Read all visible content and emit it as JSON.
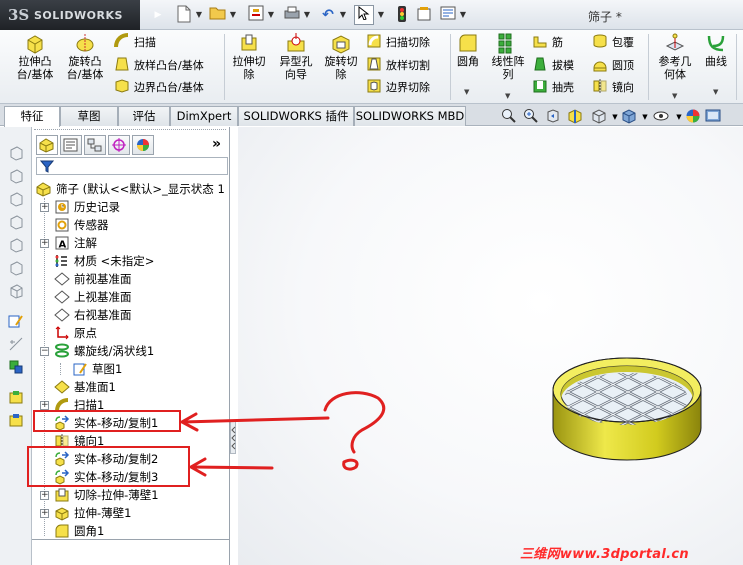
{
  "app": {
    "logo_prefix": "3S",
    "logo_name": "SOLIDWORKS",
    "document_title": "筛子 *"
  },
  "quick_toolbar": {
    "icons": [
      "new-document-icon",
      "open-icon",
      "file-properties-icon",
      "print-icon",
      "undo-icon",
      "select-icon",
      "rebuild-icon",
      "options-icon",
      "customize-icon"
    ]
  },
  "ribbon": {
    "extrude_boss": "拉伸凸台/基体",
    "extrude_boss_l1": "拉伸凸",
    "extrude_boss_l2": "台/基体",
    "revolve_boss_l1": "旋转凸",
    "revolve_boss_l2": "台/基体",
    "sweep": "扫描",
    "loft_boss": "放样凸台/基体",
    "boundary_boss": "边界凸台/基体",
    "extrude_cut_l1": "拉伸切",
    "extrude_cut_l2": "除",
    "hole_wizard_l1": "异型孔",
    "hole_wizard_l2": "向导",
    "revolve_cut_l1": "旋转切",
    "revolve_cut_l2": "除",
    "swept_cut": "扫描切除",
    "lofted_cut": "放样切割",
    "boundary_cut": "边界切除",
    "fillet": "圆角",
    "linear_pattern_l1": "线性阵",
    "linear_pattern_l2": "列",
    "rib": "筋",
    "draft": "拔模",
    "shell": "抽壳",
    "wrap": "包覆",
    "dome": "圆顶",
    "mirror": "镜向",
    "ref_geometry_l1": "参考几",
    "ref_geometry_l2": "何体",
    "curves": "曲线"
  },
  "tabs": [
    {
      "label": "特征",
      "active": true
    },
    {
      "label": "草图",
      "active": false
    },
    {
      "label": "评估",
      "active": false
    },
    {
      "label": "DimXpert",
      "active": false
    },
    {
      "label": "SOLIDWORKS 插件",
      "active": false
    },
    {
      "label": "SOLIDWORKS MBD",
      "active": false
    }
  ],
  "tree": {
    "root": "筛子 (默认<<默认>_显示状态 1",
    "items": [
      {
        "label": "历史记录",
        "icon": "history-icon",
        "expandable": true
      },
      {
        "label": "传感器",
        "icon": "sensor-icon",
        "expandable": false
      },
      {
        "label": "注解",
        "icon": "annotation-icon",
        "expandable": true
      },
      {
        "label": "材质 <未指定>",
        "icon": "material-icon",
        "expandable": false
      },
      {
        "label": "前视基准面",
        "icon": "plane-icon",
        "expandable": false
      },
      {
        "label": "上视基准面",
        "icon": "plane-icon",
        "expandable": false
      },
      {
        "label": "右视基准面",
        "icon": "plane-icon",
        "expandable": false
      },
      {
        "label": "原点",
        "icon": "origin-icon",
        "expandable": false
      },
      {
        "label": "螺旋线/涡状线1",
        "icon": "helix-icon",
        "expandable": true
      },
      {
        "label": "草图1",
        "icon": "sketch-icon",
        "expandable": false,
        "child": true
      },
      {
        "label": "基准面1",
        "icon": "plane-icon",
        "expandable": false
      },
      {
        "label": "扫描1",
        "icon": "sweep-icon",
        "expandable": true
      },
      {
        "label": "实体-移动/复制1",
        "icon": "move-copy-body-icon",
        "expandable": false
      },
      {
        "label": "镜向1",
        "icon": "mirror-icon",
        "expandable": false
      },
      {
        "label": "实体-移动/复制2",
        "icon": "move-copy-body-icon",
        "expandable": false
      },
      {
        "label": "实体-移动/复制3",
        "icon": "move-copy-body-icon",
        "expandable": false
      },
      {
        "label": "切除-拉伸-薄壁1",
        "icon": "extrude-cut-icon",
        "expandable": true
      },
      {
        "label": "拉伸-薄壁1",
        "icon": "extrude-boss-icon",
        "expandable": true
      },
      {
        "label": "圆角1",
        "icon": "fillet-icon",
        "expandable": false
      }
    ]
  },
  "colors": {
    "annotation_red": "#e02020",
    "model_yellow": "#d9d21a",
    "accent_blue": "#2a64c5"
  },
  "watermark": "三维网www.3dportal.cn"
}
